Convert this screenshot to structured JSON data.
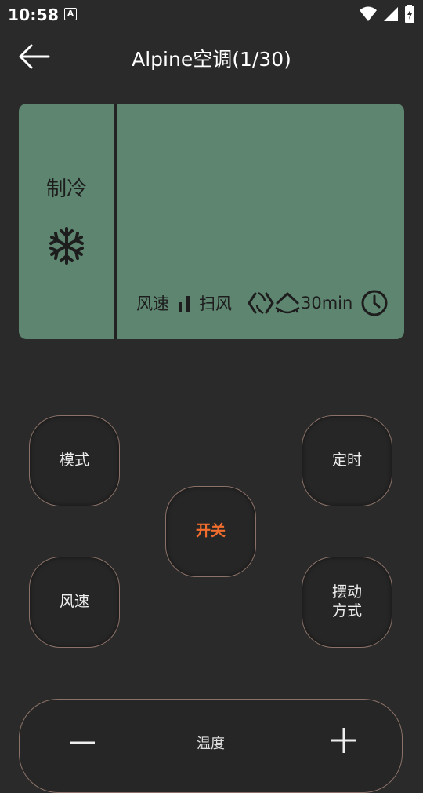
{
  "status_bar": {
    "time": "10:58",
    "badge": "A"
  },
  "header": {
    "title": "Alpine空调(1/30)"
  },
  "display": {
    "mode": "制冷",
    "fan_label": "风速",
    "swing_label": "扫风",
    "timer_value": "30min"
  },
  "buttons": {
    "mode": "模式",
    "timer": "定时",
    "power": "开关",
    "fan": "风速",
    "swing_line1": "摆动",
    "swing_line2": "方式"
  },
  "temperature": {
    "label": "温度"
  },
  "colors": {
    "background": "#2a2a2a",
    "lcd": "#5e8570",
    "accent": "#f06d2e",
    "button_border": "#8b7268"
  }
}
